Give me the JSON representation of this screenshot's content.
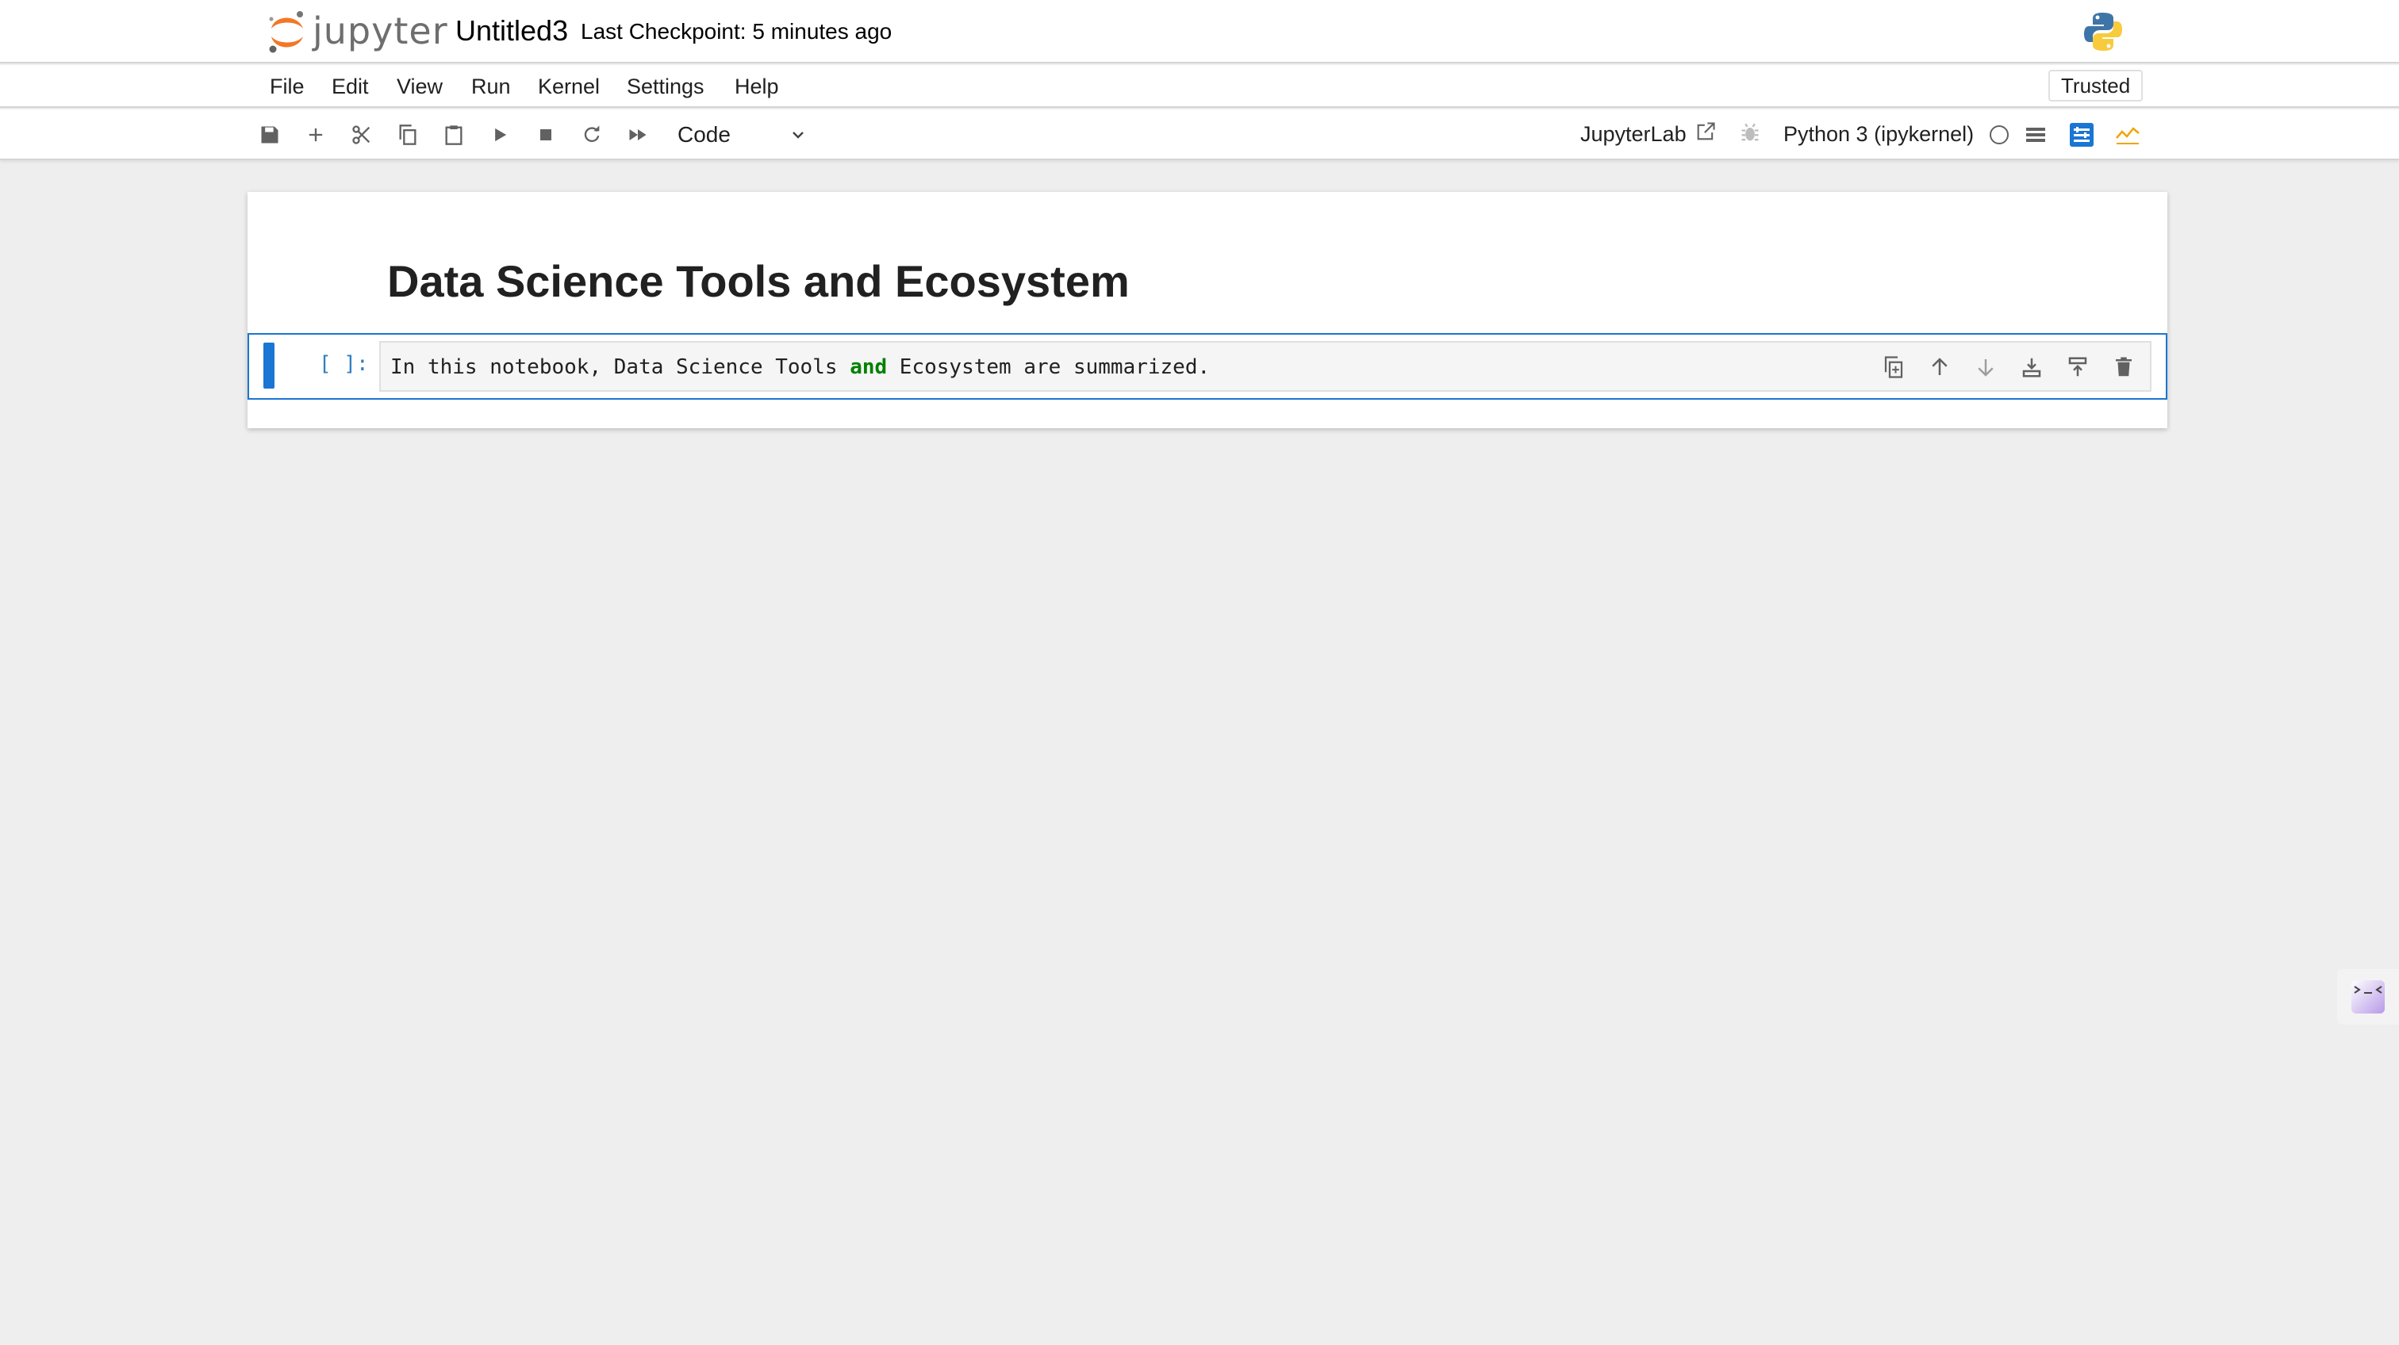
{
  "header": {
    "logo_text": "jupyter",
    "notebook_title": "Untitled3",
    "checkpoint": "Last Checkpoint: 5 minutes ago"
  },
  "menubar": {
    "items": [
      "File",
      "Edit",
      "View",
      "Run",
      "Kernel",
      "Settings",
      "Help"
    ],
    "trusted": "Trusted"
  },
  "toolbar": {
    "buttons": [
      "save-icon",
      "add-icon",
      "cut-icon",
      "copy-icon",
      "paste-icon",
      "run-icon",
      "stop-icon",
      "restart-icon",
      "fast-forward-icon"
    ],
    "cell_type": "Code",
    "jupyterlab_link": "JupyterLab",
    "kernel_name": "Python 3 (ipykernel)",
    "accent_color": "#1976d2"
  },
  "notebook": {
    "markdown_heading": "Data Science Tools and Ecosystem",
    "code_cell": {
      "prompt": "[ ]:",
      "code_before": "In this notebook, Data Science Tools ",
      "code_keyword": "and",
      "code_after": " Ecosystem are summarized."
    },
    "cell_toolbar": [
      "duplicate-icon",
      "move-up-icon",
      "move-down-icon",
      "insert-below-icon",
      "insert-above-icon",
      "delete-icon"
    ]
  }
}
